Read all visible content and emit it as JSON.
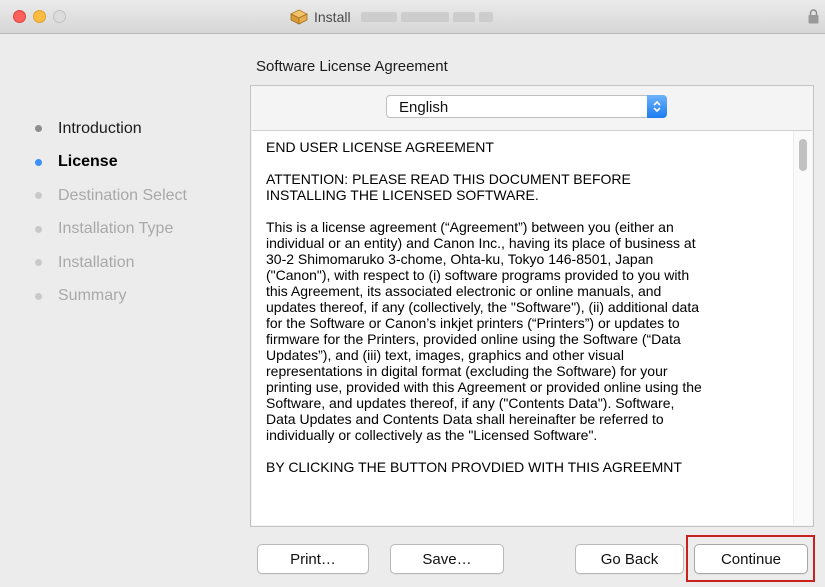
{
  "window": {
    "title": "Install",
    "title_redacted": true
  },
  "section_title": "Software License Agreement",
  "sidebar": {
    "steps": [
      {
        "label": "Introduction",
        "state": "done"
      },
      {
        "label": "License",
        "state": "current"
      },
      {
        "label": "Destination Select",
        "state": "pending"
      },
      {
        "label": "Installation Type",
        "state": "pending"
      },
      {
        "label": "Installation",
        "state": "pending"
      },
      {
        "label": "Summary",
        "state": "pending"
      }
    ]
  },
  "language": {
    "selected": "English"
  },
  "license": {
    "paragraphs": [
      "END USER LICENSE AGREEMENT",
      "ATTENTION: PLEASE READ THIS DOCUMENT BEFORE\nINSTALLING THE LICENSED SOFTWARE.",
      "This is a license agreement (“Agreement”) between you (either an\nindividual or an entity) and Canon Inc., having its place of business at\n30-2 Shimomaruko 3-chome, Ohta-ku, Tokyo 146-8501, Japan\n(\"Canon\"), with respect to (i) software programs provided to you with\nthis Agreement, its associated electronic or online manuals, and\nupdates thereof, if any (collectively, the \"Software\"), (ii) additional data\nfor the Software or Canon’s inkjet printers (“Printers”) or updates to\nfirmware for the Printers, provided online using the Software (“Data\nUpdates”), and (iii) text, images, graphics and other visual\nrepresentations in digital format (excluding the Software) for your\nprinting use, provided with this Agreement or provided online using the\nSoftware, and updates thereof, if any (\"Contents Data\").  Software,\nData Updates and Contents Data shall hereinafter be referred to\nindividually or collectively as the \"Licensed Software\".",
      "BY CLICKING THE BUTTON PROVDIED WITH THIS AGREEMNT"
    ]
  },
  "buttons": {
    "print": "Print…",
    "save": "Save…",
    "go_back": "Go Back",
    "continue": "Continue"
  },
  "colors": {
    "current_step": "#3d8ef6",
    "highlight": "#c9211e",
    "close": "#fc605c",
    "minimize": "#fdbc40"
  }
}
